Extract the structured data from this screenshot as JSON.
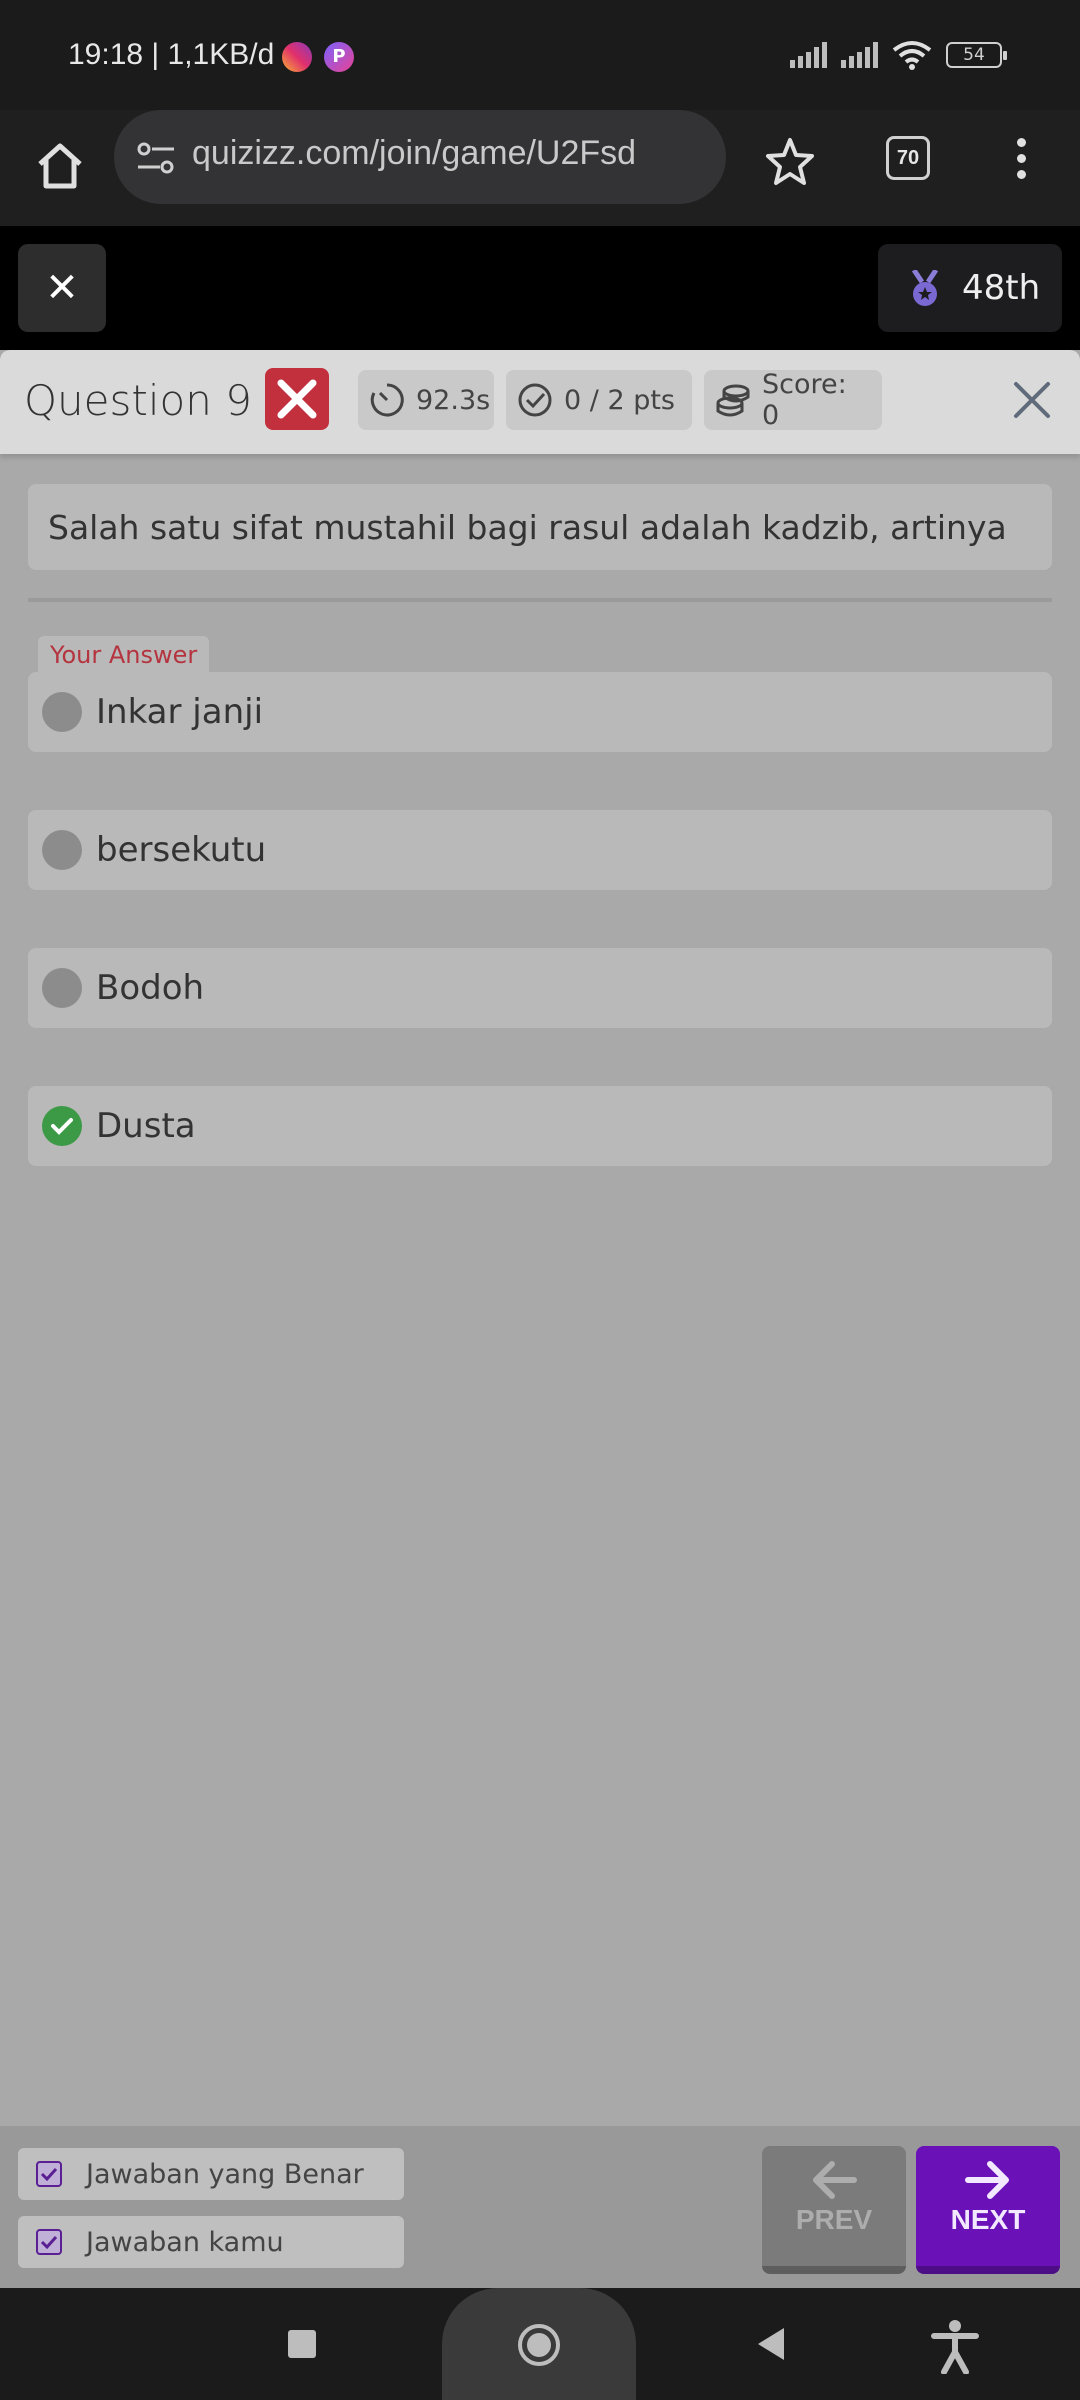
{
  "status_bar": {
    "time_speed": "19:18 | 1,1KB/d",
    "battery": "54",
    "icons": [
      "instagram-icon",
      "picsart-icon",
      "signal-icon",
      "signal-icon",
      "wifi-icon",
      "battery-icon"
    ]
  },
  "browser": {
    "url": "quizizz.com/join/game/U2Fsd",
    "tab_count": "70",
    "icons": [
      "home-icon",
      "site-settings-icon",
      "star-icon",
      "tabs-icon",
      "more-icon"
    ]
  },
  "game_header": {
    "close_icon": "close-icon",
    "rank": "48th",
    "rank_icon": "medal-icon"
  },
  "question_header": {
    "title": "Question 9",
    "result_icon": "wrong-x-icon",
    "time": "92.3s",
    "points": "0 / 2 pts",
    "score": "Score: 0"
  },
  "question": {
    "text": "Salah satu sifat mustahil bagi rasul adalah kadzib, artinya"
  },
  "answers": {
    "your_answer_label": "Your Answer",
    "options": [
      {
        "label": "Inkar janji",
        "state": "selected-wrong"
      },
      {
        "label": "bersekutu",
        "state": "neutral"
      },
      {
        "label": "Bodoh",
        "state": "neutral"
      },
      {
        "label": "Dusta",
        "state": "correct"
      }
    ]
  },
  "footer": {
    "legend": [
      {
        "label": "Jawaban yang Benar",
        "checked": true
      },
      {
        "label": "Jawaban kamu",
        "checked": true
      }
    ],
    "prev_label": "PREV",
    "next_label": "NEXT"
  },
  "colors": {
    "wrong": "#c2303e",
    "correct": "#3c9a47",
    "accent": "#6a12b8"
  }
}
